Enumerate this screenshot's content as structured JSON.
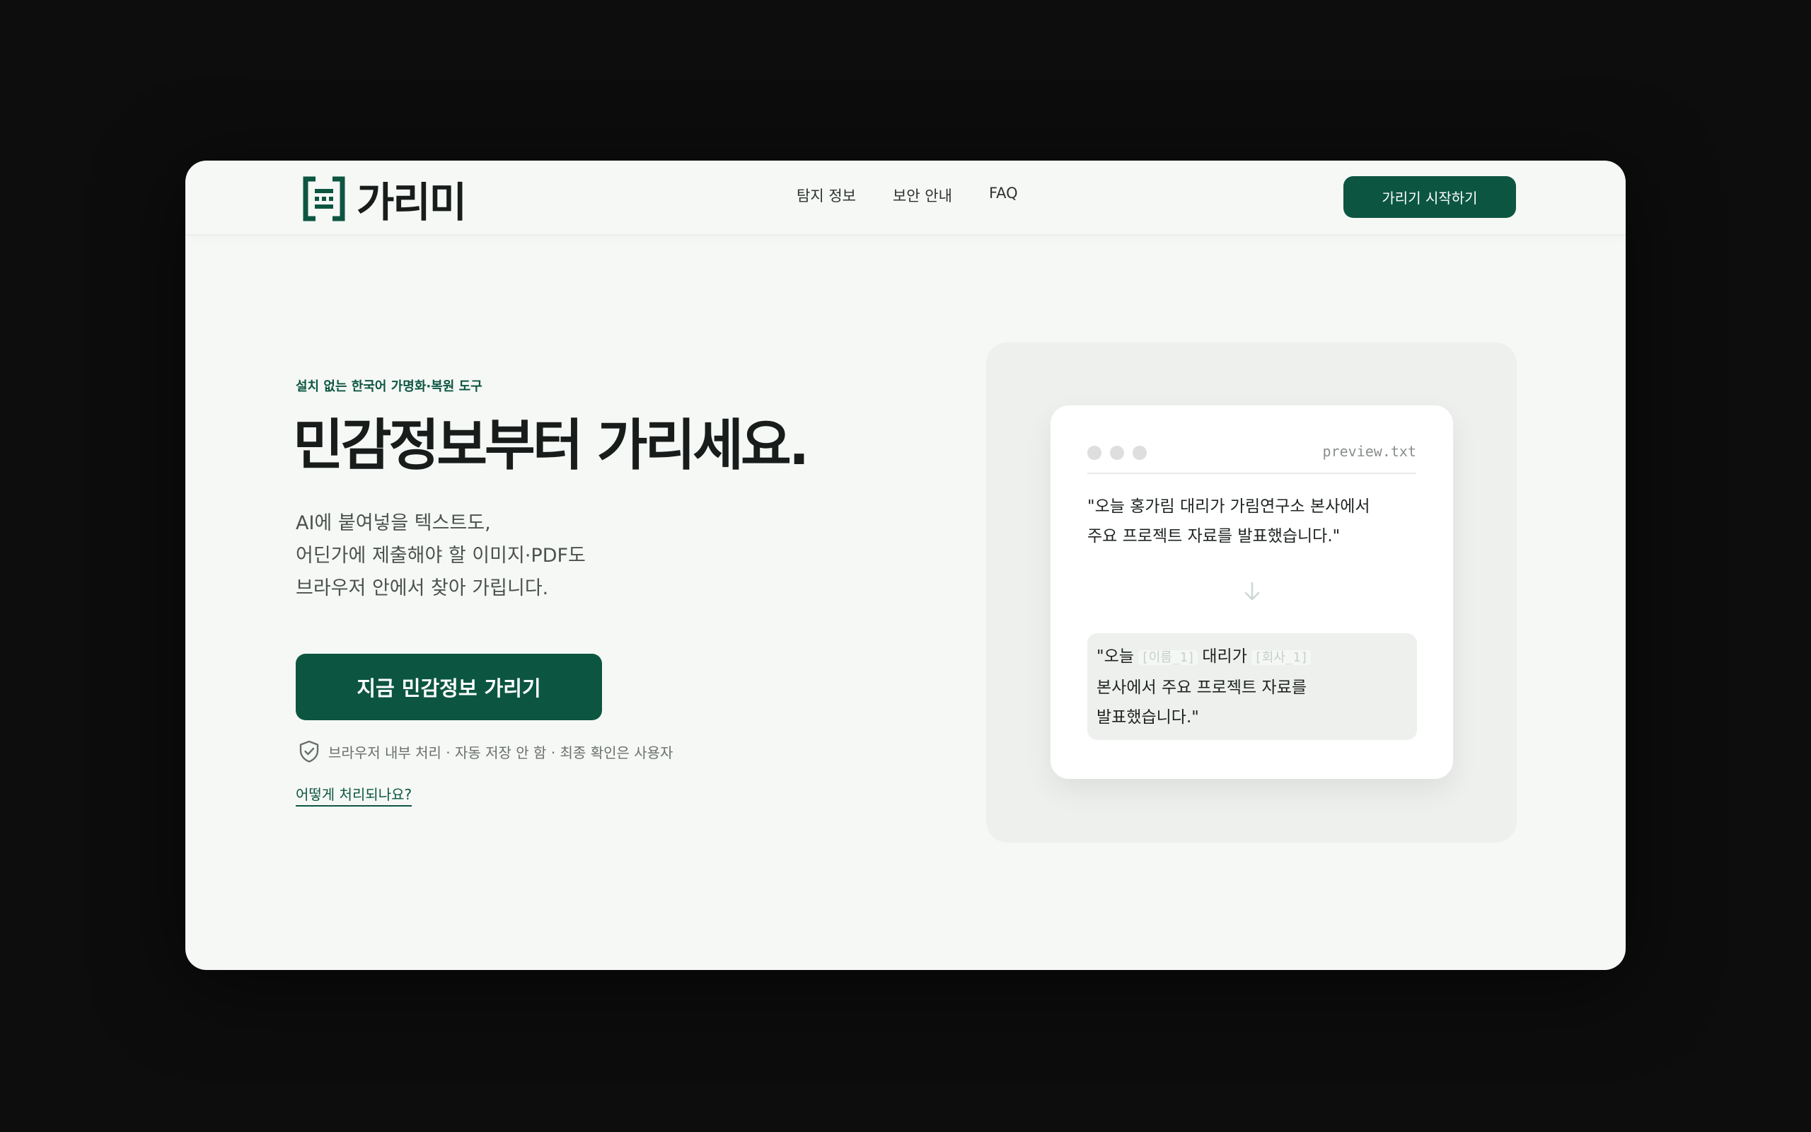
{
  "brand": {
    "name": "가리미",
    "accent": "#0c5641"
  },
  "nav": {
    "links": [
      "탐지 정보",
      "보안 안내",
      "FAQ"
    ],
    "cta_label": "가리기 시작하기"
  },
  "hero": {
    "eyebrow": "설치 없는 한국어 가명화·복원 도구",
    "headline": "민감정보부터 가리세요.",
    "description": [
      "AI에 붙여넣을 텍스트도,",
      "어딘가에 제출해야 할 이미지·PDF도",
      "브라우저 안에서 찾아 가립니다."
    ],
    "cta_label": "지금 민감정보 가리기",
    "trust_text": "브라우저 내부 처리 · 자동 저장 안 함 · 최종 확인은 사용자",
    "how_link": "어떻게 처리되나요?"
  },
  "preview": {
    "filename": "preview.txt",
    "original_lines": [
      "\"오늘  홍가림  대리가  가림연구소  본사에서",
      "주요 프로젝트 자료를 발표했습니다.\""
    ],
    "result": {
      "prefix": "\"오늘",
      "token_name": "[이름_1]",
      "middle": "대리가",
      "token_company": "[회사_1]",
      "line2": "본사에서 주요 프로젝트 자료를",
      "line3": "발표했습니다.\""
    }
  }
}
